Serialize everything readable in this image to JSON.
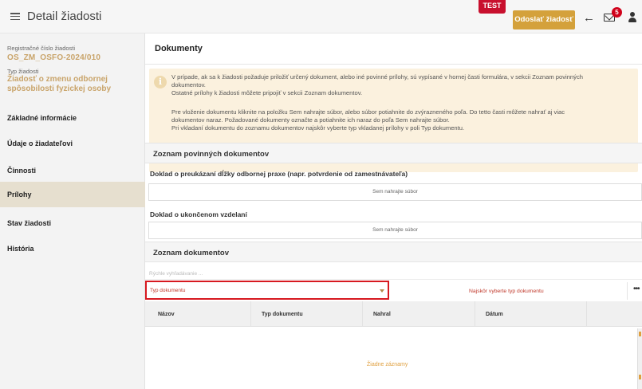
{
  "header": {
    "title": "Detail žiadosti",
    "env_badge": "TEST",
    "send_button": "Odoslať žiadosť",
    "notification_count": "5"
  },
  "sidebar": {
    "reg_number_label": "Registračné číslo žiadosti",
    "reg_number_value": "OS_ZM_OSFO-2024/010",
    "type_label": "Typ žiadosti",
    "type_value": "Žiadosť o zmenu odbornej spôsobilosti fyzickej osoby",
    "nav": [
      {
        "label": "Základné informácie",
        "active": false
      },
      {
        "label": "Údaje o žiadateľovi",
        "active": false
      },
      {
        "label": "Činnosti",
        "active": false
      },
      {
        "label": "Prílohy",
        "active": true
      },
      {
        "label": "Stav žiadosti",
        "active": false
      },
      {
        "label": "História",
        "active": false
      }
    ]
  },
  "main": {
    "heading": "Dokumenty",
    "info": {
      "line1": "V prípade, ak sa k žiadosti požaduje priložiť určený dokument, alebo iné povinné prílohy, sú vypísané v hornej časti formulára, v sekcii Zoznam povinných",
      "line2": "dokumentov.",
      "line3": "Ostatné prílohy k žiadosti môžete pripojiť v sekcii Zoznam dokumentov.",
      "line4": "Pre vloženie dokumentu kliknite na položku Sem nahrajte súbor, alebo súbor potiahnite do zvýrazneného poľa. Do tetto časti môžete nahrať aj viac",
      "line5": "dokumentov naraz. Požadované dokumenty označte a potiahnite ich naraz do poľa Sem nahrajte súbor.",
      "line6": "Pri vkladaní dokumentu do zoznamu dokumentov najskôr vyberte typ vkladanej prílohy v poli Typ dokumentu."
    },
    "required_section_title": "Zoznam povinných dokumentov",
    "required_docs": [
      {
        "title": "Doklad o preukázaní dĺžky odbornej praxe (napr. potvrdenie od zamestnávateľa)",
        "upload_label": "Sem nahrajte súbor"
      },
      {
        "title": "Doklad o ukončenom vzdelaní",
        "upload_label": "Sem nahrajte súbor"
      }
    ],
    "documents_section_title": "Zoznam dokumentov",
    "quick_search_placeholder": "Rýchle vyhľadávanie ...",
    "type_select_placeholder": "Typ dokumentu",
    "type_warning": "Najskôr vyberte typ dokumentu",
    "more_label": "•••",
    "table": {
      "columns": [
        "Názov",
        "Typ dokumentu",
        "Nahral",
        "Dátum"
      ],
      "empty_text": "Žiadne záznamy"
    }
  },
  "colors": {
    "accent": "#d4a13b",
    "gold_text": "#c9a46a",
    "alert_red": "#d71920",
    "info_bg": "#fbf1de"
  }
}
